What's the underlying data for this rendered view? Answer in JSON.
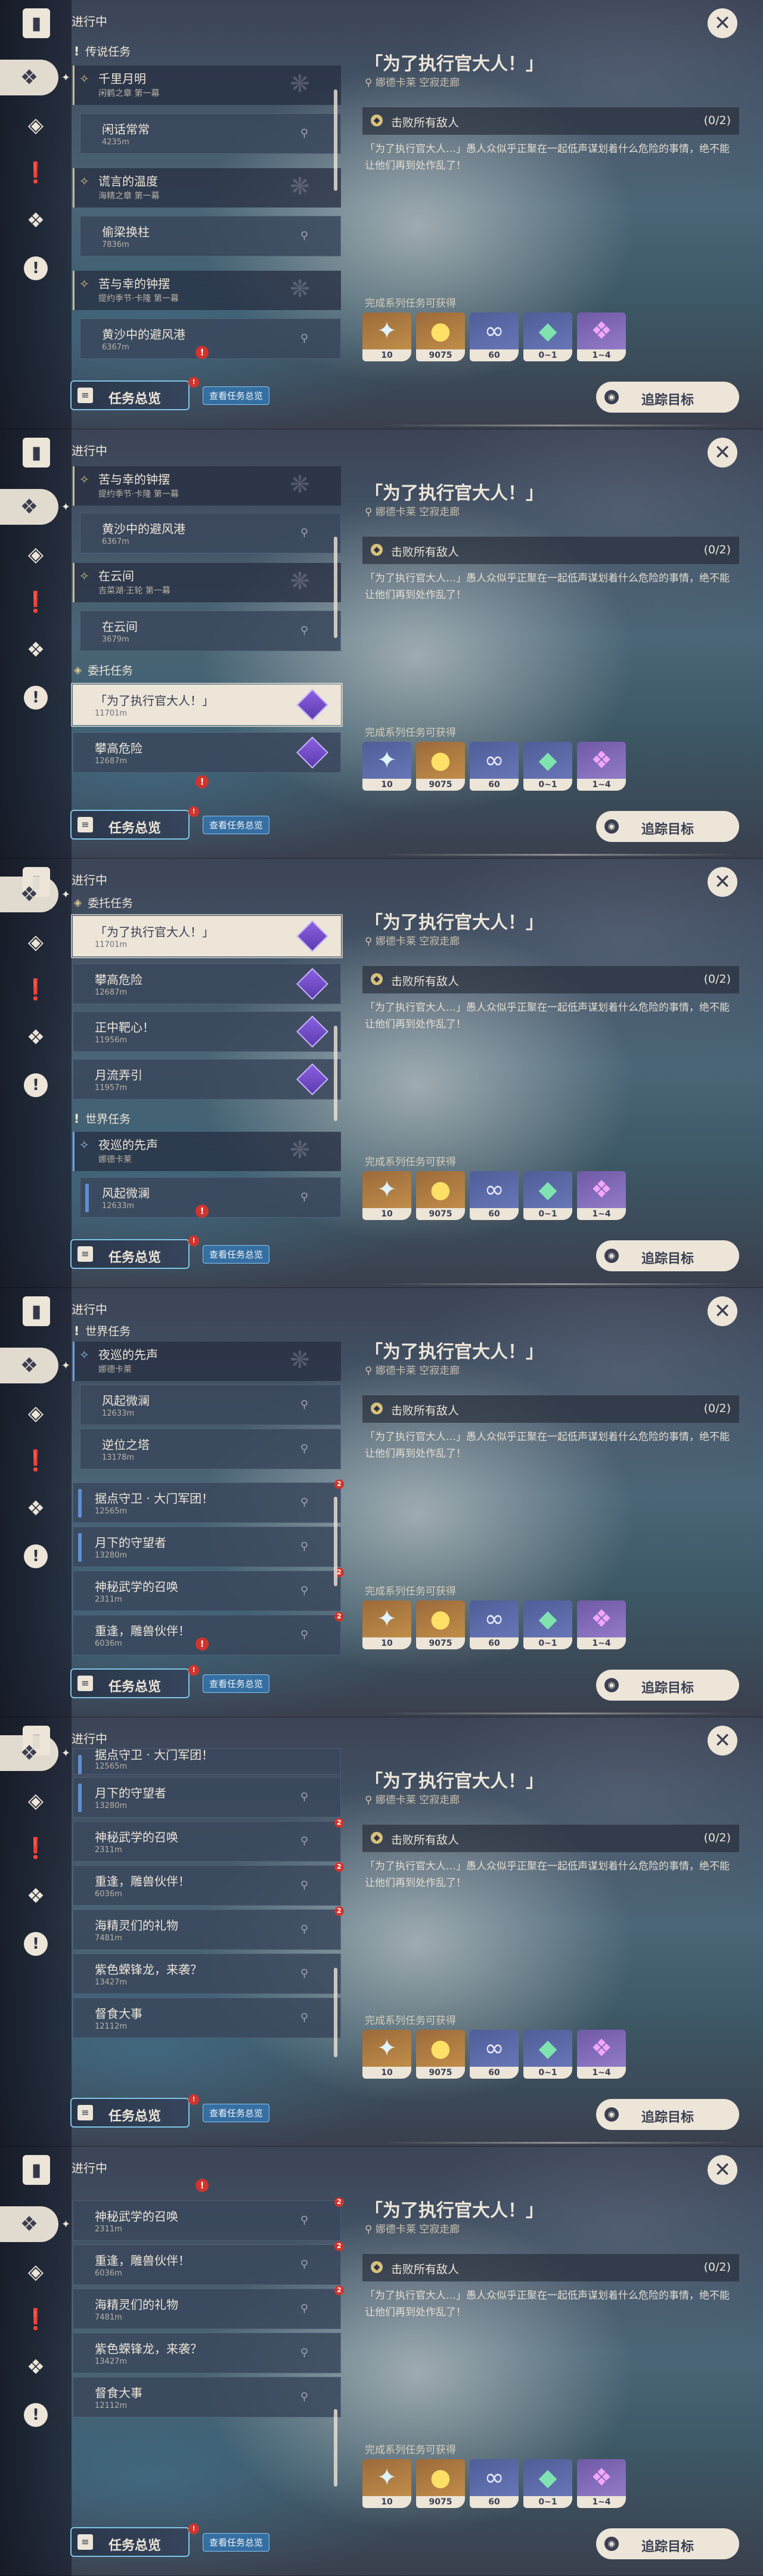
{
  "header_label": "进行中",
  "overview": {
    "label": "任务总览",
    "badge": "!",
    "view_link": "查看任务总览"
  },
  "track_label": "追踪目标",
  "close_glyph": "✕",
  "detail": {
    "title": "「为了执行官大人！」",
    "location": "娜德卡莱  空寂走廊",
    "objective": "击败所有敌人",
    "progress": "(0/2)",
    "description": "「为了执行官大人…」愚人众似乎正聚在一起低声谋划着什么危险的事情，绝不能让他们再到处作乱了！",
    "rewards_label": "完成系列任务可获得",
    "rewards": [
      {
        "icon": "adventure-exp-icon",
        "count": "10"
      },
      {
        "icon": "mora-icon",
        "count": "9075"
      },
      {
        "icon": "companionship-exp-icon",
        "count": "60"
      },
      {
        "icon": "crystal-green-icon",
        "count": "0~1"
      },
      {
        "icon": "crystal-purple-icon",
        "count": "1~4"
      }
    ]
  },
  "categories": {
    "legend": "传说任务",
    "commission": "委托任务",
    "world": "世界任务"
  },
  "quests": {
    "qianli": {
      "title": "千里月明",
      "sub": "闲鹤之章 第一幕"
    },
    "xianqin": {
      "title": "闲话常常",
      "dist": "4235m"
    },
    "huangyan": {
      "title": "谎言的温度",
      "sub": "海精之章 第一幕"
    },
    "touliang": {
      "title": "偷梁换柱",
      "dist": "7836m"
    },
    "kuxing": {
      "title": "苦与幸的钟摆",
      "sub": "提约季节·卡隆 第一幕"
    },
    "huangsha": {
      "title": "黄沙中的避风港",
      "dist": "6367m"
    },
    "zaiyun": {
      "title": "在云间",
      "sub": "吉菜湖·王轮 第一幕"
    },
    "zaiyun_row": {
      "title": "在云间",
      "dist": "3679m"
    },
    "zhixing": {
      "title": "「为了执行官大人！」",
      "dist": "11701m"
    },
    "pangao": {
      "title": "攀高危险",
      "dist": "12687m"
    },
    "zhengzhong": {
      "title": "正中靶心！",
      "dist": "11956m"
    },
    "yueliu": {
      "title": "月流弄引",
      "dist": "11957m"
    },
    "yexun": {
      "title": "夜巡的先声",
      "sub": "娜德卡莱"
    },
    "fengqi": {
      "title": "风起微澜",
      "dist": "12633m"
    },
    "niwei": {
      "title": "逆位之塔",
      "dist": "13178m"
    },
    "judian": {
      "title": "据点守卫 · 大门军团！",
      "dist": "12565m"
    },
    "yuexia": {
      "title": "月下的守望者",
      "dist": "13280m"
    },
    "shenmi": {
      "title": "神秘武学的召唤",
      "dist": "2311m"
    },
    "chongfeng": {
      "title": "重逢，雕兽伙伴！",
      "dist": "6036m"
    },
    "haijing": {
      "title": "海精灵们的礼物",
      "dist": "7481m"
    },
    "zise": {
      "title": "紫色蝾锋龙，来袭？",
      "dist": "13427m"
    },
    "dushi": {
      "title": "督食大事",
      "dist": "12112m"
    }
  }
}
